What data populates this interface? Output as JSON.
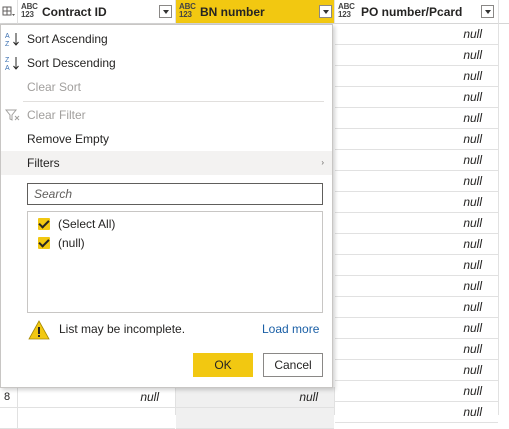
{
  "columns": [
    {
      "type_top": "ABC",
      "type_bottom": "123",
      "title": "Contract ID"
    },
    {
      "type_top": "ABC",
      "type_bottom": "123",
      "title": "BN number"
    },
    {
      "type_top": "ABC",
      "type_bottom": "123",
      "title": "PO number/Pcard"
    }
  ],
  "cell_null": "null",
  "row_number": "8",
  "menu": {
    "sort_asc": "Sort Ascending",
    "sort_desc": "Sort Descending",
    "clear_sort": "Clear Sort",
    "clear_filter": "Clear Filter",
    "remove_empty": "Remove Empty",
    "filters": "Filters",
    "filters_arrow": "›",
    "search_placeholder": "Search",
    "options": [
      {
        "label": "(Select All)",
        "checked": true
      },
      {
        "label": "(null)",
        "checked": true
      }
    ],
    "warning": "List may be incomplete.",
    "load_more": "Load more",
    "ok": "OK",
    "cancel": "Cancel"
  },
  "colors": {
    "accent": "#f2c811",
    "link": "#1a5fa6",
    "warning": "#f2c811"
  }
}
